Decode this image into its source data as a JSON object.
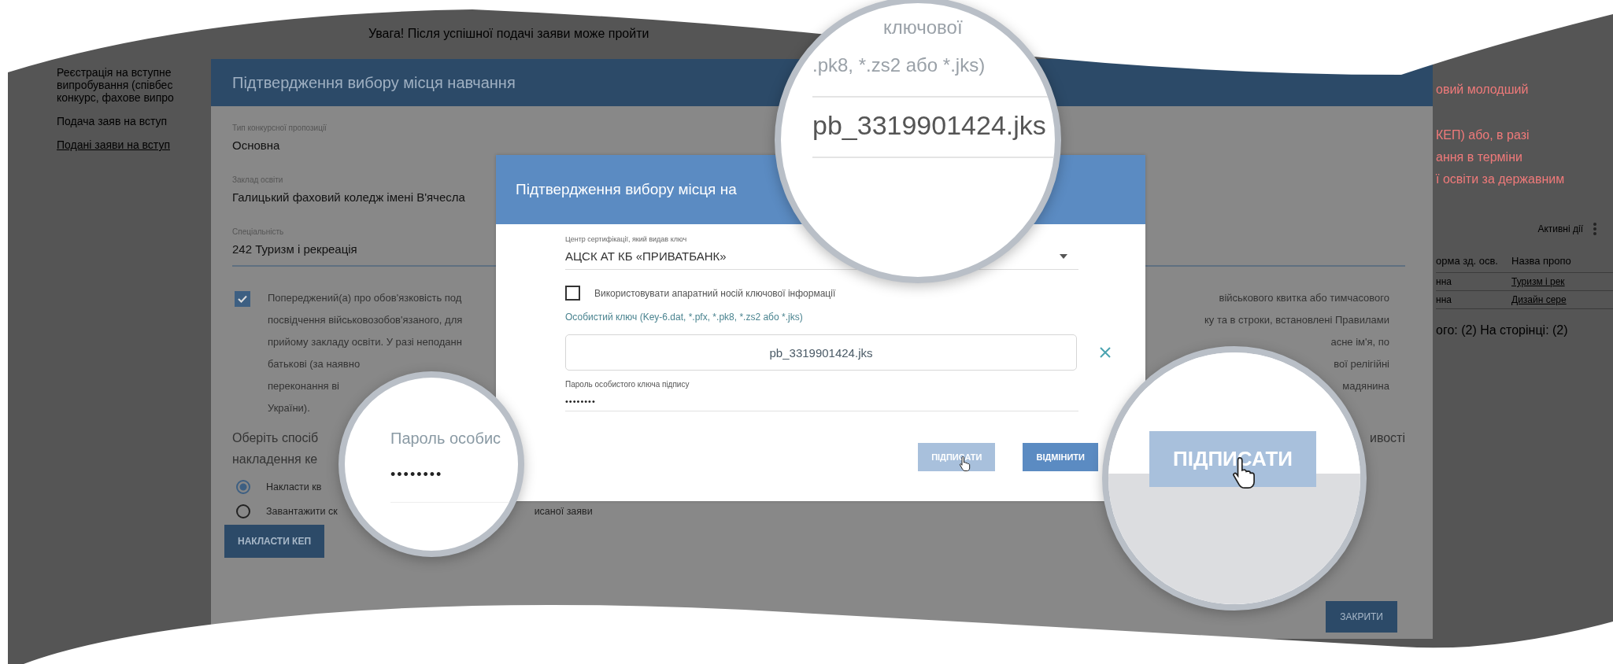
{
  "page": {
    "sidebar": [
      {
        "kind": "text",
        "lines": [
          "Реєстрація на вступне",
          "випробування (співбес",
          "конкурс, фахове випро"
        ]
      },
      {
        "kind": "text",
        "lines": [
          "Подача заяв на вступ"
        ]
      },
      {
        "kind": "link",
        "lines": [
          "Подані заяви на вступ"
        ]
      }
    ],
    "notice": "Увага! Після успішної подачі заяви може пройти",
    "right_notes": [
      [
        "овий молодший"
      ],
      [
        "КЕП) або, в разі",
        "ання в терміни",
        "ї освіти за державним"
      ]
    ],
    "actions_label": "Активні дії",
    "table": {
      "columns": [
        "орма зд. осв.",
        "Назва пропо"
      ],
      "rows": [
        [
          "нна",
          "Туризм і рек"
        ],
        [
          "нна",
          "Дизайн сере"
        ]
      ]
    },
    "pagination": "ого: (2) На сторінці: (2)"
  },
  "dialog": {
    "title": "Підтвердження вибору місця навчання",
    "fields": [
      {
        "label": "Тип конкурсної пропозиції",
        "value": "Основна"
      },
      {
        "label": "Заклад освіти",
        "value": "Галицький фаховий коледж імені В'ячесла"
      },
      {
        "label": "Спеціальність",
        "value": "242 Туризм і рекреація"
      }
    ],
    "agreement": {
      "checked": true,
      "lines": [
        {
          "left": "Попереджений(а) про обов'язковість под",
          "right": "військового квитка або тимчасового"
        },
        {
          "left": "посвідчення військовозобов'язаного, для",
          "right": "ку та в строки, встановлені Правилами"
        },
        {
          "left": "прийому закладу освіти. У разі неподанн",
          "right": "асне ім'я, по"
        },
        {
          "left": "батькові (за наявно",
          "right": "вої релігійні"
        },
        {
          "left": "переконання ві",
          "right": "мадянина"
        },
        {
          "left": "України)."
        }
      ]
    },
    "method_lines": [
      {
        "left": "Оберіть спосіб",
        "right": "ивості"
      },
      {
        "left": "накладення ке"
      }
    ],
    "options": [
      {
        "label": "Накласти кв",
        "selected": true
      },
      {
        "label": "Завантажити ск",
        "tail": "исаної заяви",
        "selected": false
      }
    ],
    "apply_button": "НАКЛАСТИ КЕП",
    "close_button": "ЗАКРИТИ"
  },
  "sign_dialog": {
    "title": "Підтвердження вибору місця на",
    "ca_label": "Центр сертифікації, який видав ключ",
    "ca_value": "АЦСК АТ КБ «ПРИВАТБАНК»",
    "hardware": {
      "label": "Використовувати апаратний носій ключової інформації",
      "checked": false
    },
    "key_label": "Особистий ключ (Key-6.dat, *.pfx, *.pk8, *.zs2 або *.jks)",
    "key_file": "pb_3319901424.jks",
    "password_label": "Пароль особистого ключа підпису",
    "password_value": "••••••••",
    "buttons": [
      {
        "label": "ПІДПИСАТИ",
        "disabled": true,
        "cursor": true
      },
      {
        "label": "ВІДМІНИТИ",
        "disabled": false,
        "cursor": false
      }
    ]
  },
  "magnifiers": [
    {
      "kind": "file",
      "lines": [
        "ключової",
        ".pk8, *.zs2 або *.jks)"
      ],
      "value": "pb_3319901424.jks"
    },
    {
      "kind": "password",
      "lines": [
        "Пароль особис"
      ],
      "value": "••••••••"
    },
    {
      "kind": "button",
      "value": "ПІДПИСАТИ",
      "disabled": true
    }
  ]
}
